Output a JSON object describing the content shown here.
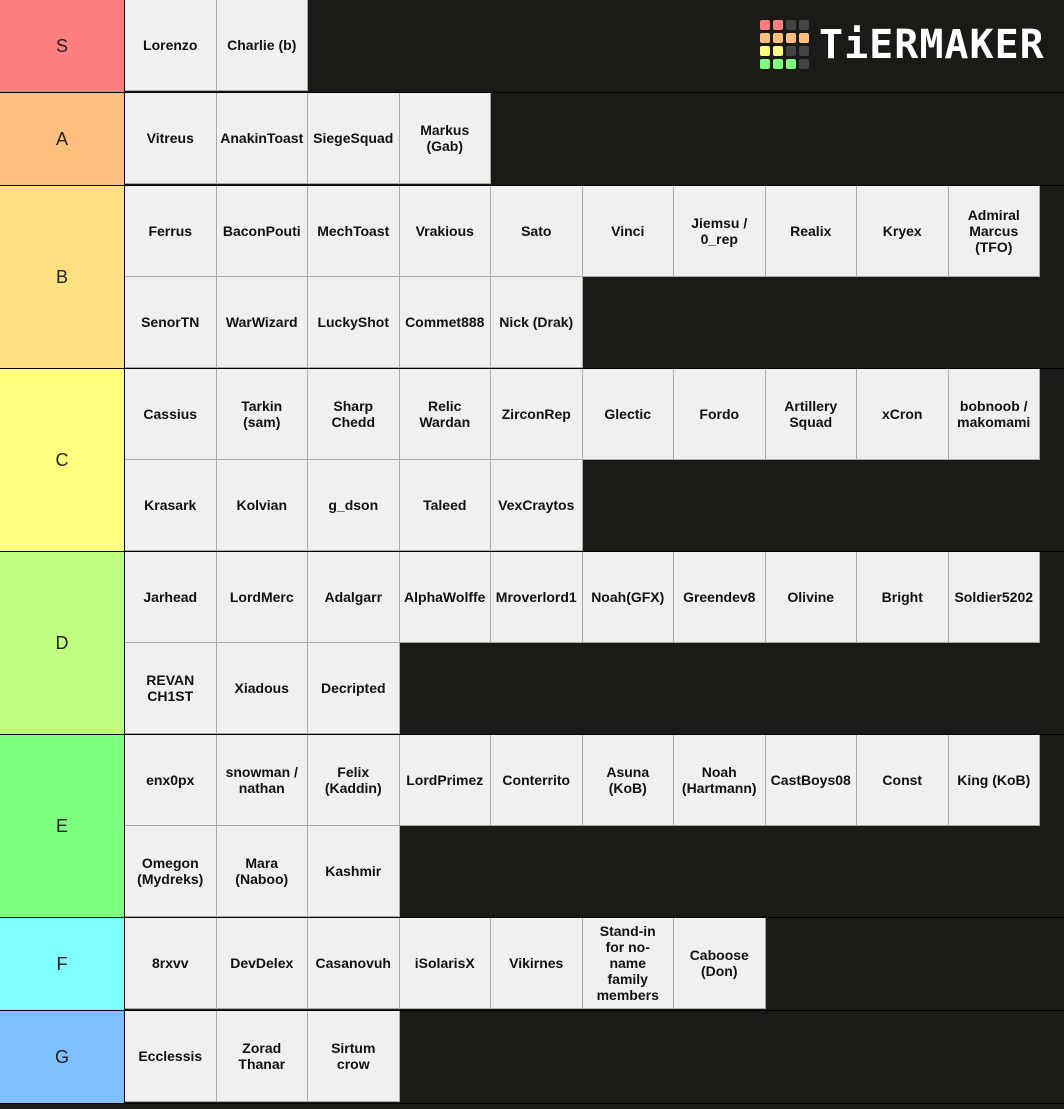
{
  "logo": {
    "text": "TiERMAKER",
    "grid_colors": [
      "#ff7f7f",
      "#ff7f7f",
      "#444",
      "#444",
      "#ffbf7f",
      "#ffbf7f",
      "#ffbf7f",
      "#ffbf7f",
      "#ffff7f",
      "#ffff7f",
      "#444",
      "#444",
      "#7fff7f",
      "#7fff7f",
      "#7fff7f",
      "#444"
    ]
  },
  "tiers": [
    {
      "label": "S",
      "color": "#ff7f7f",
      "items": [
        "Lorenzo",
        "Charlie (b)"
      ]
    },
    {
      "label": "A",
      "color": "#ffbf7f",
      "items": [
        "Vitreus",
        "AnakinToast",
        "SiegeSquad",
        "Markus\n(Gab)"
      ]
    },
    {
      "label": "B",
      "color": "#ffdf7f",
      "items": [
        "Ferrus",
        "BaconPouti",
        "MechToast",
        "Vrakious",
        "Sato",
        "Vinci",
        "Jiemsu /\n0_rep",
        "Realix",
        "Kryex",
        "Admiral\nMarcus\n(TFO)",
        "SenorTN",
        "WarWizard",
        "LuckyShot",
        "Commet888",
        "Nick (Drak)"
      ]
    },
    {
      "label": "C",
      "color": "#ffff7f",
      "items": [
        "Cassius",
        "Tarkin\n(sam)",
        "Sharp\nChedd",
        "Relic\nWardan",
        "ZirconRep",
        "Glectic",
        "Fordo",
        "Artillery\nSquad",
        "xCron",
        "bobnoob /\nmakomami",
        "Krasark",
        "Kolvian",
        "g_dson",
        "Taleed",
        "VexCraytos"
      ]
    },
    {
      "label": "D",
      "color": "#bfff7f",
      "items": [
        "Jarhead",
        "LordMerc",
        "Adalgarr",
        "AlphaWolffe",
        "Mroverlord1",
        "Noah(GFX)",
        "Greendev8",
        "Olivine",
        "Bright",
        "Soldier5202",
        "REVAN\nCH1ST",
        "Xiadous",
        "Decripted"
      ]
    },
    {
      "label": "E",
      "color": "#7fff7f",
      "items": [
        "enx0px",
        "snowman /\nnathan",
        "Felix\n(Kaddin)",
        "LordPrimez",
        "Conterrito",
        "Asuna\n(KoB)",
        "Noah\n(Hartmann)",
        "CastBoys08",
        "Const",
        "King (KoB)",
        "Omegon\n(Mydreks)",
        "Mara\n(Naboo)",
        "Kashmir"
      ]
    },
    {
      "label": "F",
      "color": "#7fffff",
      "items": [
        "8rxvv",
        "DevDelex",
        "Casanovuh",
        "iSolarisX",
        "Vikirnes",
        "Stand-in\nfor no-\nname\nfamily\nmembers",
        "Caboose\n(Don)"
      ]
    },
    {
      "label": "G",
      "color": "#7fbfff",
      "items": [
        "Ecclessis",
        "Zorad\nThanar",
        "Sirtum\ncrow"
      ]
    }
  ]
}
